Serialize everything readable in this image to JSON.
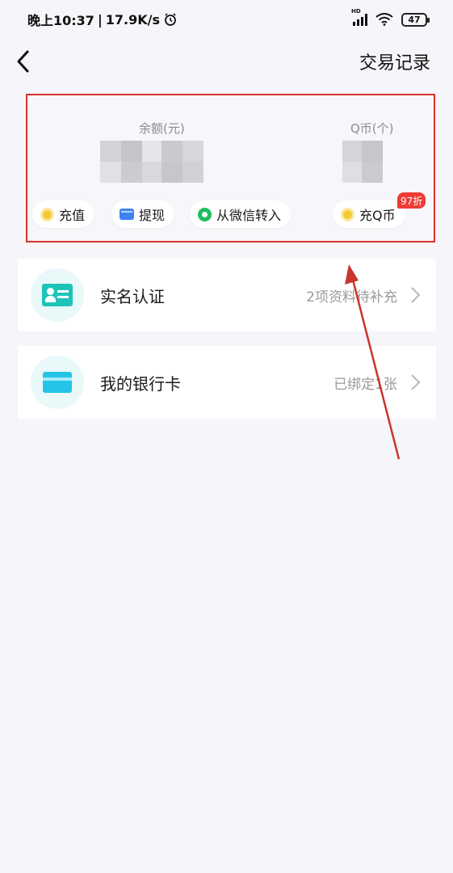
{
  "status_bar": {
    "time": "晚上10:37",
    "separator": "|",
    "speed": "17.9K/s",
    "network_label": "HD",
    "battery": "47"
  },
  "header": {
    "title": "交易记录"
  },
  "balance": {
    "balance_label": "余额(元)",
    "qcoin_label": "Q币(个)",
    "actions": [
      {
        "label": "充值",
        "icon": "coin-icon"
      },
      {
        "label": "提现",
        "icon": "wallet-icon"
      },
      {
        "label": "从微信转入",
        "icon": "wechat-icon"
      },
      {
        "label": "充Q币",
        "icon": "coin-icon"
      }
    ],
    "discount_badge": "97折"
  },
  "list": [
    {
      "title": "实名认证",
      "subtitle": "2项资料待补充",
      "icon": "id-card-icon"
    },
    {
      "title": "我的银行卡",
      "subtitle": "已绑定1张",
      "icon": "bank-card-icon"
    }
  ],
  "colors": {
    "accent_red": "#d8332a",
    "teal": "#1ec3b8",
    "blue": "#24c4e8"
  }
}
